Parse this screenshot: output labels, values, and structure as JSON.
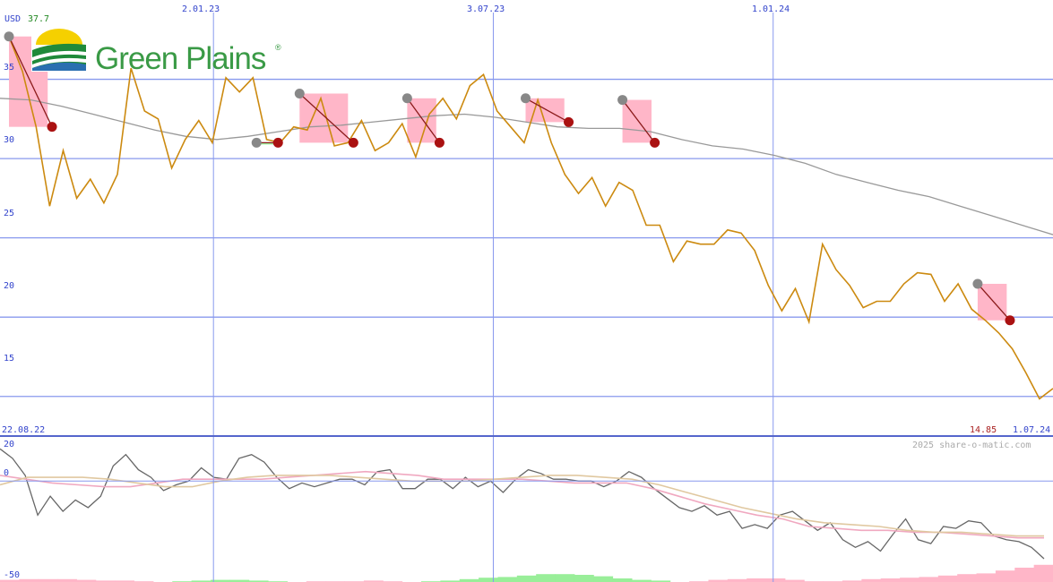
{
  "header": {
    "currency": "USD",
    "last_value": "37.7",
    "start_date": "22.08.22",
    "end_date": "1.07.24",
    "end_value": "14.85",
    "copyright": "2025 share-o-matic.com"
  },
  "logo": {
    "name": "Green Plains",
    "mark": "®"
  },
  "colors": {
    "price": "#cc8a10",
    "ma_long": "#999999",
    "grid": "#8899ee",
    "grid_light": "#aabbee",
    "high_point": "#888888",
    "low_point": "#aa1111",
    "gain_fill": "#99ee99",
    "loss_fill": "#ffb6c8",
    "osc": "#666666",
    "osc_signal1": "#f0a8c0",
    "osc_signal2": "#e0c8a0"
  },
  "chart_data": [
    {
      "type": "line",
      "title": "",
      "x_range": [
        "2022-08-22",
        "2024-07-01"
      ],
      "x_tick_labels": [
        "2.01.23",
        "3.07.23",
        "1.01.24"
      ],
      "y_tick_labels": [
        "35",
        "30",
        "25",
        "20",
        "15"
      ],
      "ylim": [
        12.5,
        40
      ],
      "grid": true,
      "x": [
        "2022-08-22",
        "2022-09-05",
        "2022-09-19",
        "2022-10-03",
        "2022-10-10",
        "2022-10-17",
        "2022-10-31",
        "2022-11-07",
        "2022-11-14",
        "2022-11-28",
        "2022-12-12",
        "2022-12-26",
        "2023-01-09",
        "2023-01-16",
        "2023-01-30",
        "2023-02-06",
        "2023-02-13",
        "2023-02-27",
        "2023-03-06",
        "2023-03-13",
        "2023-03-27",
        "2023-04-03",
        "2023-04-17",
        "2023-04-24",
        "2023-05-08",
        "2023-05-15",
        "2023-05-29",
        "2023-06-05",
        "2023-06-19",
        "2023-06-26",
        "2023-07-10",
        "2023-07-24",
        "2023-07-31",
        "2023-08-14",
        "2023-08-21",
        "2023-09-04",
        "2023-09-11",
        "2023-09-25",
        "2023-10-02",
        "2023-10-16",
        "2023-10-23",
        "2023-11-06",
        "2023-11-13",
        "2023-11-27",
        "2023-12-04",
        "2023-12-18",
        "2023-12-25",
        "2024-01-08",
        "2024-01-15",
        "2024-01-29",
        "2024-02-05",
        "2024-02-19",
        "2024-02-26",
        "2024-03-11",
        "2024-03-18",
        "2024-04-01",
        "2024-04-08",
        "2024-04-22",
        "2024-04-29",
        "2024-05-13",
        "2024-05-20",
        "2024-06-03",
        "2024-06-10",
        "2024-06-24",
        "2024-07-01"
      ],
      "series": [
        {
          "role": "price",
          "values": [
            37.7,
            35.5,
            32.0,
            27.0,
            30.5,
            27.5,
            28.7,
            27.2,
            29.0,
            35.7,
            33.0,
            32.5,
            29.4,
            31.2,
            32.4,
            31.0,
            35.1,
            34.2,
            35.1,
            31.2,
            31.0,
            32.0,
            31.8,
            33.8,
            30.8,
            31.0,
            32.4,
            30.5,
            31.0,
            32.2,
            30.1,
            32.8,
            33.8,
            32.5,
            34.6,
            35.3,
            33.0,
            32.0,
            31.0,
            33.7,
            31.0,
            29.0,
            27.8,
            28.8,
            27.0,
            28.5,
            28.0,
            25.8,
            25.8,
            23.5,
            24.8,
            24.6,
            24.6,
            25.5,
            25.3,
            24.2,
            22.0,
            20.4,
            21.8,
            19.7,
            24.6,
            23.0,
            22.0,
            20.6,
            21.0,
            21.0,
            22.1,
            22.8,
            22.7,
            21.0,
            22.1,
            20.5,
            19.8,
            19.0,
            18.0,
            16.5,
            14.85,
            15.5
          ]
        },
        {
          "role": "moving-average",
          "values": [
            33.8,
            33.7,
            33.3,
            32.8,
            32.3,
            31.8,
            31.4,
            31.2,
            31.4,
            31.7,
            32.0,
            32.1,
            32.3,
            32.5,
            32.7,
            32.8,
            32.6,
            32.3,
            32.0,
            31.9,
            31.9,
            31.7,
            31.2,
            30.8,
            30.6,
            30.2,
            29.7,
            29.0,
            28.5,
            28.0,
            27.6,
            27.0,
            26.4,
            25.8,
            25.2
          ]
        }
      ],
      "signals": [
        {
          "from": "2022-08-22",
          "from_value": 37.7,
          "to": "2022-09-19",
          "to_value": 32.0,
          "result": "loss"
        },
        {
          "from": "2023-01-30",
          "from_value": 31.0,
          "to": "2023-02-13",
          "to_value": 31.0,
          "result": "gain"
        },
        {
          "from": "2023-02-27",
          "from_value": 34.1,
          "to": "2023-04-03",
          "to_value": 31.0,
          "result": "loss"
        },
        {
          "from": "2023-05-08",
          "from_value": 33.8,
          "to": "2023-05-29",
          "to_value": 31.0,
          "result": "loss"
        },
        {
          "from": "2023-07-24",
          "from_value": 33.8,
          "to": "2023-08-21",
          "to_value": 32.3,
          "result": "loss"
        },
        {
          "from": "2023-09-25",
          "from_value": 33.7,
          "to": "2023-10-16",
          "to_value": 31.0,
          "result": "loss"
        },
        {
          "from": "2024-05-13",
          "from_value": 22.1,
          "to": "2024-06-03",
          "to_value": 19.8,
          "result": "loss"
        }
      ]
    },
    {
      "type": "line",
      "title": "",
      "y_tick_labels": [
        "20",
        "0",
        "-50"
      ],
      "ylim": [
        -50,
        20
      ],
      "grid": true,
      "series": [
        {
          "role": "oscillator",
          "values": [
            17,
            12,
            3,
            -18,
            -8,
            -16,
            -10,
            -14,
            -8,
            8,
            14,
            6,
            2,
            -5,
            -2,
            0,
            7,
            2,
            1,
            12,
            14,
            10,
            2,
            -4,
            -1,
            -3,
            -1,
            1,
            1,
            -2,
            5,
            6,
            -4,
            -4,
            1,
            1,
            -4,
            2,
            -3,
            0,
            -6,
            1,
            6,
            4,
            1,
            1,
            0,
            0,
            -3,
            0,
            5,
            2,
            -4,
            -9,
            -14,
            -16,
            -13,
            -18,
            -16,
            -25,
            -23,
            -25,
            -18,
            -16,
            -21,
            -26,
            -22,
            -31,
            -35,
            -32,
            -37,
            -28,
            -20,
            -31,
            -33,
            -24,
            -25,
            -21,
            -22,
            -29,
            -31,
            -32,
            -35,
            -41
          ]
        },
        {
          "role": "signal",
          "values": [
            3,
            1,
            -1,
            -2,
            -3,
            -3,
            -1,
            1,
            1,
            1,
            1,
            2,
            3,
            4,
            5,
            4,
            3,
            1,
            1,
            1,
            1,
            0,
            -1,
            -1,
            -1,
            -4,
            -8,
            -12,
            -15,
            -18,
            -20,
            -24,
            -25,
            -26,
            -26,
            -27,
            -27,
            -28,
            -29,
            -30,
            -30
          ]
        },
        {
          "role": "signal-slow",
          "values": [
            -2,
            2,
            2,
            2,
            1,
            -1,
            -3,
            -3,
            0,
            2,
            3,
            3,
            3,
            2,
            1,
            0,
            0,
            0,
            1,
            2,
            3,
            3,
            2,
            1,
            -2,
            -6,
            -10,
            -14,
            -17,
            -20,
            -22,
            -23,
            -24,
            -26,
            -27,
            -27,
            -28,
            -29,
            -29
          ]
        },
        {
          "role": "histogram",
          "values": [
            -3,
            -4,
            -4,
            -4,
            -3,
            -2,
            -2,
            -1,
            0,
            1,
            2,
            3,
            3,
            2,
            1,
            0,
            -1,
            -1,
            -1,
            -2,
            -1,
            0,
            1,
            2,
            4,
            6,
            7,
            9,
            11,
            11,
            10,
            8,
            5,
            3,
            2,
            0,
            -1,
            -3,
            -4,
            -5,
            -5,
            -3,
            -1,
            -1,
            -2,
            -4,
            -5,
            -6,
            -7,
            -9,
            -11,
            -12,
            -16,
            -20,
            -24
          ]
        }
      ]
    }
  ]
}
